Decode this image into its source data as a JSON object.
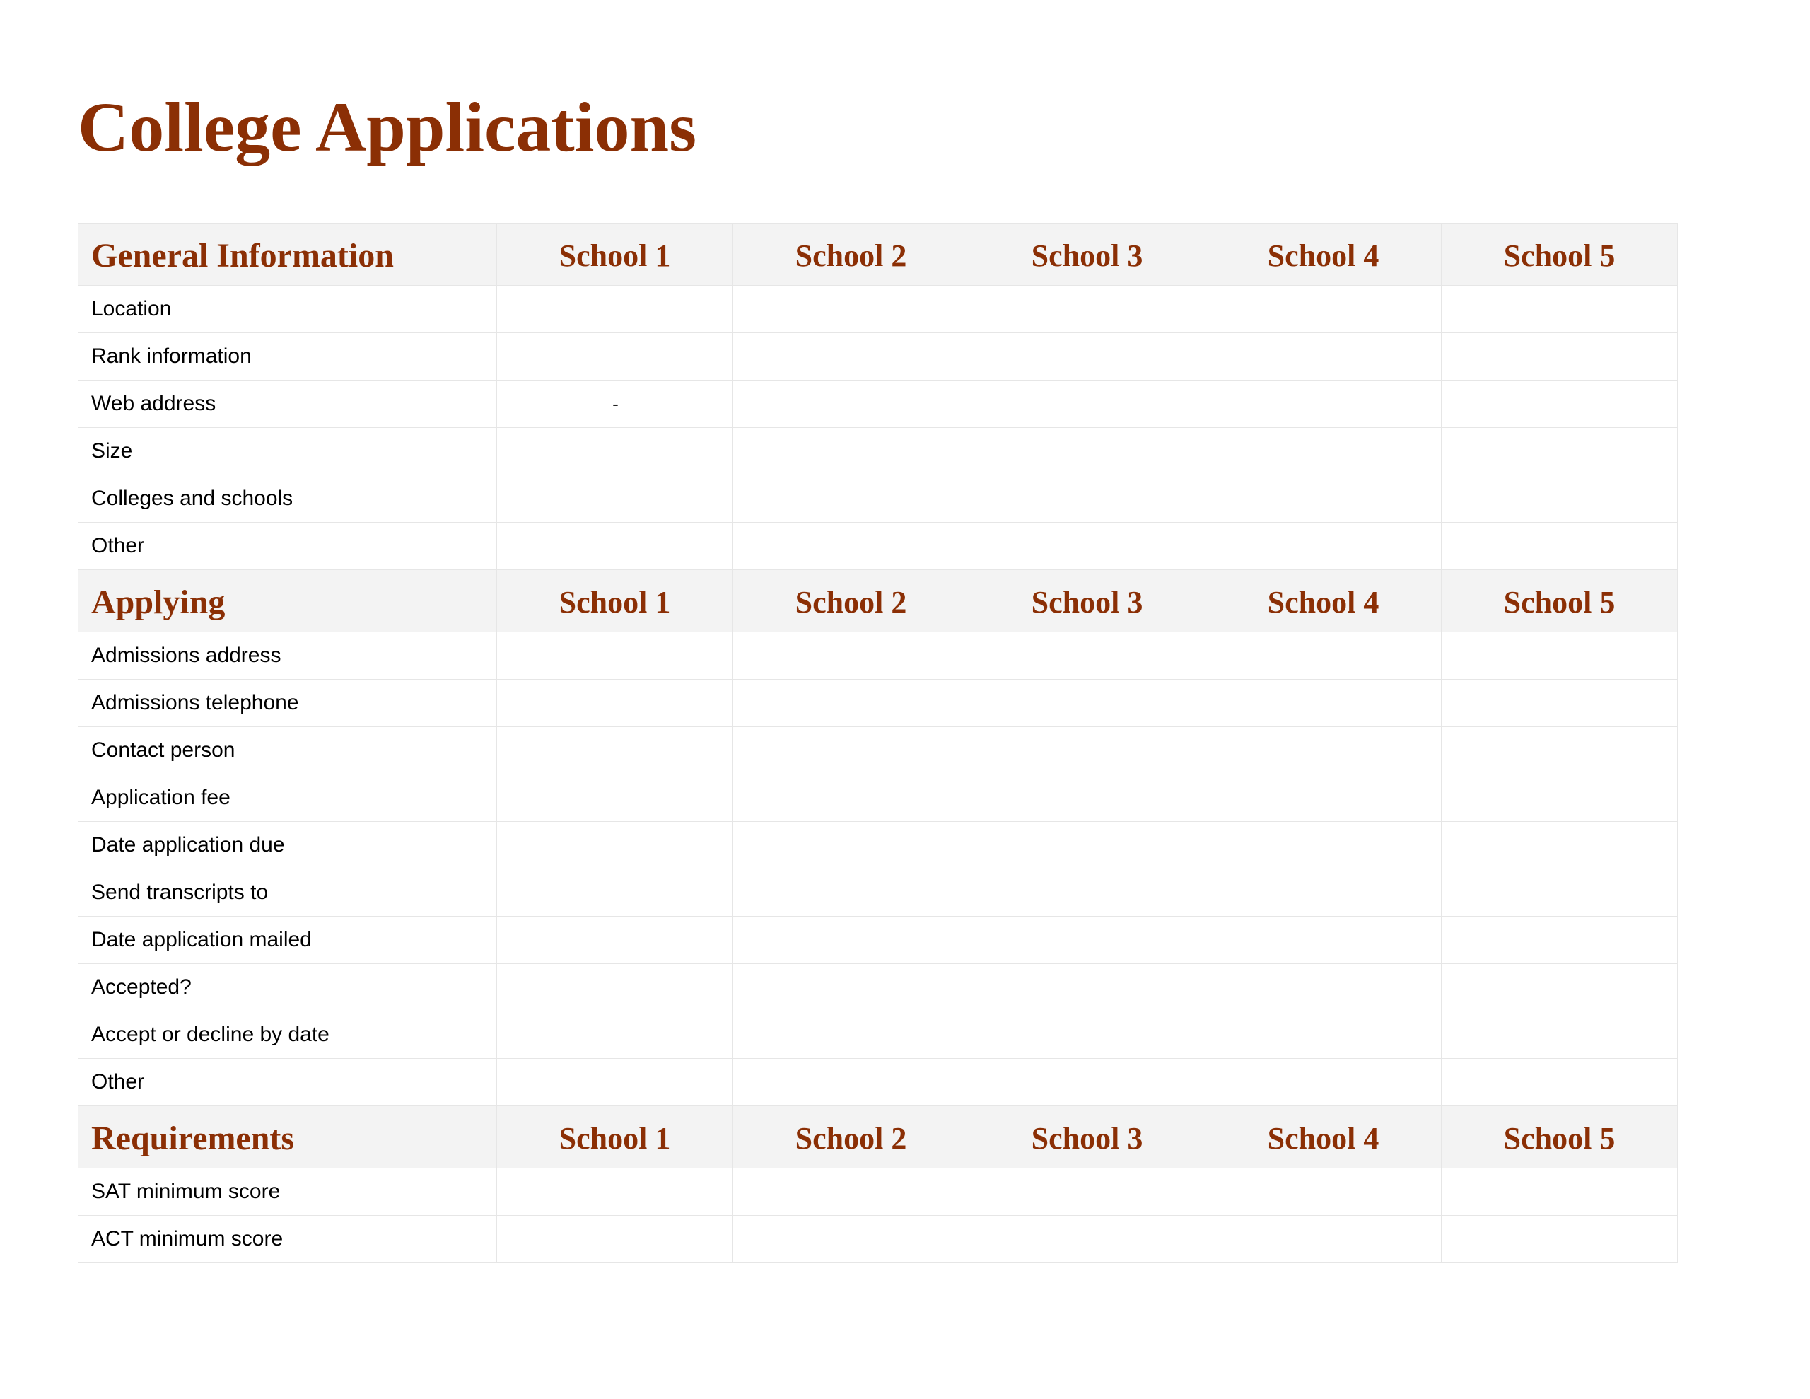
{
  "title": "College Applications",
  "schools": [
    "School 1",
    "School 2",
    "School 3",
    "School 4",
    "School 5"
  ],
  "sections": [
    {
      "title": "General Information",
      "rows": [
        {
          "label": "Location",
          "values": [
            "",
            "",
            "",
            "",
            ""
          ]
        },
        {
          "label": "Rank information",
          "values": [
            "",
            "",
            "",
            "",
            ""
          ]
        },
        {
          "label": "Web address",
          "values": [
            "-",
            "",
            "",
            "",
            ""
          ]
        },
        {
          "label": "Size",
          "values": [
            "",
            "",
            "",
            "",
            ""
          ]
        },
        {
          "label": "Colleges and schools",
          "values": [
            "",
            "",
            "",
            "",
            ""
          ]
        },
        {
          "label": "Other",
          "values": [
            "",
            "",
            "",
            "",
            ""
          ]
        }
      ]
    },
    {
      "title": "Applying",
      "rows": [
        {
          "label": "Admissions address",
          "values": [
            "",
            "",
            "",
            "",
            ""
          ]
        },
        {
          "label": "Admissions telephone",
          "values": [
            "",
            "",
            "",
            "",
            ""
          ]
        },
        {
          "label": "Contact person",
          "values": [
            "",
            "",
            "",
            "",
            ""
          ]
        },
        {
          "label": "Application fee",
          "values": [
            "",
            "",
            "",
            "",
            ""
          ]
        },
        {
          "label": "Date application due",
          "values": [
            "",
            "",
            "",
            "",
            ""
          ]
        },
        {
          "label": "Send transcripts to",
          "values": [
            "",
            "",
            "",
            "",
            ""
          ]
        },
        {
          "label": "Date application mailed",
          "values": [
            "",
            "",
            "",
            "",
            ""
          ]
        },
        {
          "label": "Accepted?",
          "values": [
            "",
            "",
            "",
            "",
            ""
          ]
        },
        {
          "label": "Accept or decline by date",
          "values": [
            "",
            "",
            "",
            "",
            ""
          ]
        },
        {
          "label": "Other",
          "values": [
            "",
            "",
            "",
            "",
            ""
          ]
        }
      ]
    },
    {
      "title": "Requirements",
      "rows": [
        {
          "label": "SAT minimum score",
          "values": [
            "",
            "",
            "",
            "",
            ""
          ]
        },
        {
          "label": "ACT minimum score",
          "values": [
            "",
            "",
            "",
            "",
            ""
          ]
        }
      ]
    }
  ]
}
